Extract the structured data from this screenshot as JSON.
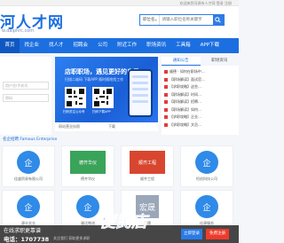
{
  "topbar": {
    "links": "欢迎来到河源市人才网 登录 注册"
  },
  "header": {
    "logo_text": "河人才网",
    "domain": "w.daiphrc.com",
    "search_type": "职位名",
    "search_placeholder": "请输入职位名称关键字"
  },
  "nav": {
    "items": [
      "首页",
      "找企业",
      "找人才",
      "招聘会",
      "公司",
      "附近工作",
      "职场资讯",
      "工具箱",
      "APP下载"
    ]
  },
  "login": {
    "username_placeholder": "用户名/手机号",
    "password_placeholder": "密码"
  },
  "banner": {
    "title": "店职职场，遇见更好的自己",
    "subtitle": "扫描二维码 下载APP 随时随地找工作",
    "qr_caption_1": "扫码关注公众号",
    "qr_caption_2": "扫码下载APP"
  },
  "under_banner": {
    "item1": "网站营业执照",
    "item2": "下载"
  },
  "news": {
    "tabs": [
      "通知公告",
      "职场资讯"
    ],
    "items": [
      "顺德 · 如何在职场中…",
      "【职场解读】面试官…",
      "【求职攻略】这些…",
      "【职场解读】时间…",
      "【职场解读】招聘…",
      "【职场解读】如何…",
      "【求职攻略】企业…",
      "【求职攻略】文员…"
    ]
  },
  "section": {
    "title": "名企招聘 Famous Enterprise"
  },
  "companies": [
    {
      "logo": "企",
      "name": "佳盛贸易有限公司",
      "color": "#2f8ae8"
    },
    {
      "logo": "德齐华仪",
      "name": "德齐华仪",
      "color": "#3aa35a"
    },
    {
      "logo": "顺齐工程",
      "name": "顺齐工程",
      "color": "#d9462f"
    },
    {
      "logo": "企",
      "name": "恒创科技公司",
      "color": "#2f8ae8"
    },
    {
      "logo": "企",
      "name": "源丰实业",
      "color": "#2f8ae8"
    },
    {
      "logo": "企",
      "name": "骏达物流",
      "color": "#2f8ae8"
    },
    {
      "logo": "宏晟",
      "name": "宏晟",
      "color": "#9aa7b8"
    },
    {
      "logo": "企",
      "name": "佳源服务",
      "color": "#2f8ae8"
    }
  ],
  "popup": {
    "line1": "在线求职更靠谱",
    "line2": "电话：1707738",
    "small": "关注我们 获取更多求职",
    "watermark": "便民店",
    "btn_a": "立即登录",
    "btn_b": "免费注册"
  }
}
